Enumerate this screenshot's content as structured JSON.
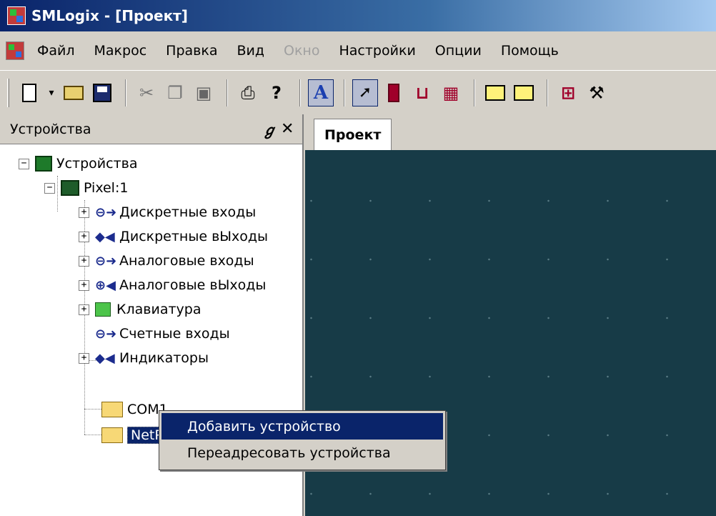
{
  "window": {
    "title": "SMLogix - [Проект]"
  },
  "menu": {
    "items": [
      {
        "label": "Файл",
        "disabled": false
      },
      {
        "label": "Макрос",
        "disabled": false
      },
      {
        "label": "Правка",
        "disabled": false
      },
      {
        "label": "Вид",
        "disabled": false
      },
      {
        "label": "Окно",
        "disabled": true
      },
      {
        "label": "Настройки",
        "disabled": false
      },
      {
        "label": "Опции",
        "disabled": false
      },
      {
        "label": "Помощь",
        "disabled": false
      }
    ]
  },
  "toolbar": {
    "text_button": "A",
    "help_glyph": "?"
  },
  "panel": {
    "title": "Устройства",
    "pin_glyph": "ℊ",
    "close_glyph": "✕"
  },
  "tree": {
    "root": "Устройства",
    "device": "Pixel:1",
    "children": [
      "Дискретные входы",
      "Дискретные вЫходы",
      "Аналоговые входы",
      "Аналоговые вЫходы",
      "Клавиатура",
      "Счетные входы",
      "Индикаторы"
    ],
    "ports": [
      "COM1",
      "NetPort"
    ]
  },
  "tabs": {
    "project": "Проект"
  },
  "context_menu": {
    "items": [
      "Добавить устройство",
      "Переадресовать устройства"
    ]
  }
}
